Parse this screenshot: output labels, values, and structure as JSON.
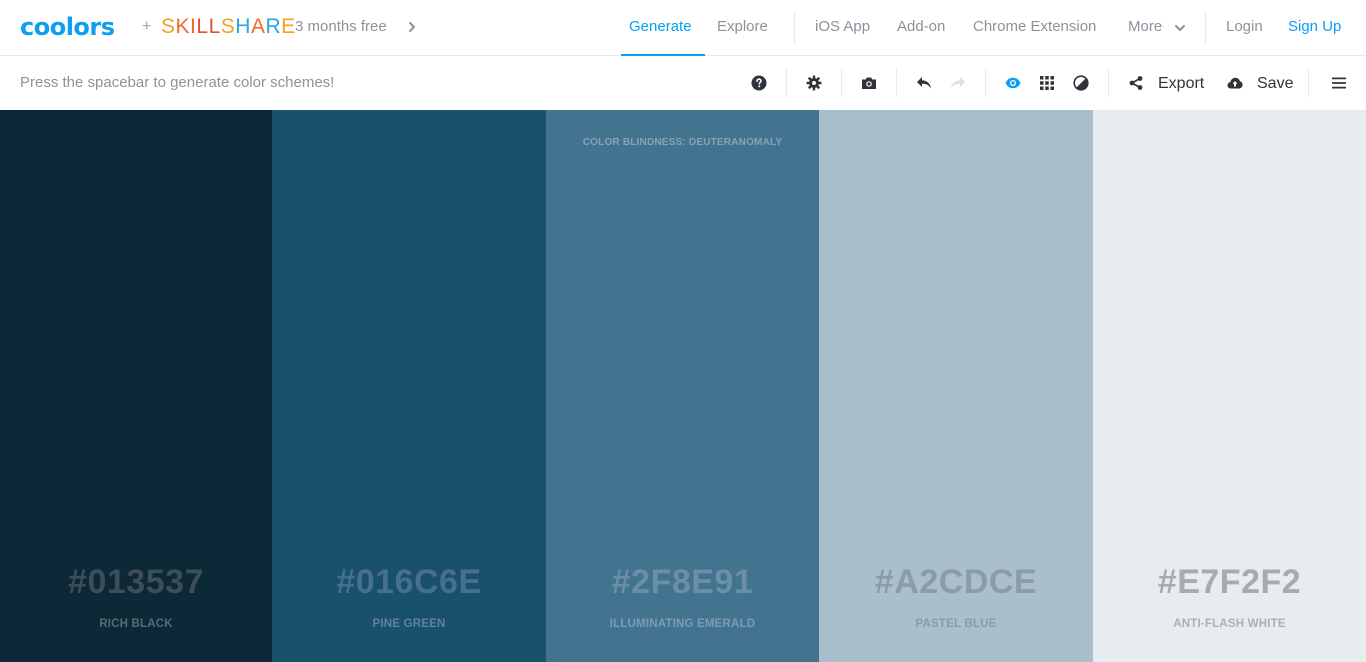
{
  "header": {
    "logo": "coolors",
    "plus": "+",
    "partner_letters": [
      {
        "ch": "S",
        "color": "#f4a020"
      },
      {
        "ch": "K",
        "color": "#f06a2a"
      },
      {
        "ch": "I",
        "color": "#f06a2a"
      },
      {
        "ch": "L",
        "color": "#e0503a"
      },
      {
        "ch": "L",
        "color": "#e0503a"
      },
      {
        "ch": "S",
        "color": "#f4a020"
      },
      {
        "ch": "H",
        "color": "#2aa6e0"
      },
      {
        "ch": "A",
        "color": "#f06a2a"
      },
      {
        "ch": "R",
        "color": "#2aa6e0"
      },
      {
        "ch": "E",
        "color": "#f4a020"
      }
    ],
    "promo": "3 months free",
    "nav": {
      "generate": "Generate",
      "explore": "Explore",
      "ios_app": "iOS App",
      "add_on": "Add-on",
      "chrome_extension": "Chrome Extension",
      "more": "More",
      "login": "Login",
      "sign_up": "Sign Up"
    }
  },
  "toolbar": {
    "hint": "Press the spacebar to generate color schemes!",
    "export": "Export",
    "save": "Save",
    "icons": [
      "help-icon",
      "gear-icon",
      "camera-icon",
      "undo-icon",
      "redo-icon",
      "eye-icon",
      "grid-icon",
      "contrast-icon",
      "share-icon",
      "cloud-upload-icon",
      "menu-icon"
    ]
  },
  "palette": {
    "color_blindness_label": "COLOR BLINDNESS: DEUTERANOMALY",
    "colors": [
      {
        "hex": "#013537",
        "name": "RICH BLACK",
        "display_bg": "#0d2836",
        "text_color": "#3c4e58",
        "name_color": "#5a6a72"
      },
      {
        "hex": "#016C6E",
        "name": "PINE GREEN",
        "display_bg": "#19506c",
        "text_color": "#47708a",
        "name_color": "#5f849a"
      },
      {
        "hex": "#2F8E91",
        "name": "ILLUMINATING EMERALD",
        "display_bg": "#42738f",
        "text_color": "#6a8fa6",
        "name_color": "#7b9db2"
      },
      {
        "hex": "#A2CDCE",
        "name": "PASTEL BLUE",
        "display_bg": "#a9bfcc",
        "text_color": "#8c9ca6",
        "name_color": "#8a9ba5"
      },
      {
        "hex": "#E7F2F2",
        "name": "ANTI-FLASH WHITE",
        "display_bg": "#e7ecf0",
        "text_color": "#a4acb2",
        "name_color": "#a9b1b7"
      }
    ]
  },
  "colors": {
    "accent": "#0a9ff0",
    "nav_text": "#8c939c",
    "toolbar_text": "#2f343b"
  }
}
